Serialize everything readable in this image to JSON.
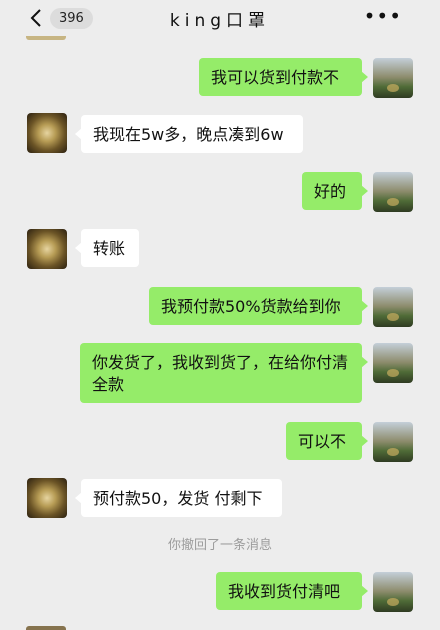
{
  "header": {
    "back_icon": "chevron-left-icon",
    "unread_count": "396",
    "title": "king口罩",
    "more_icon": "more-dots-icon"
  },
  "messages": [
    {
      "side": "right",
      "text": "我可以货到付款不"
    },
    {
      "side": "left",
      "text": "我现在5w多，晚点凑到6w"
    },
    {
      "side": "right",
      "text": "好的"
    },
    {
      "side": "left",
      "text": "转账"
    },
    {
      "side": "right",
      "text": "我预付款50%货款给到你"
    },
    {
      "side": "right",
      "text": "你发货了，我收到货了，在给你付清全款"
    },
    {
      "side": "right",
      "text": "可以不"
    },
    {
      "side": "left",
      "text": "预付款50，发货 付剩下"
    },
    {
      "side": "system",
      "text": "你撤回了一条消息"
    },
    {
      "side": "right",
      "text": "我收到货付清吧"
    }
  ],
  "colors": {
    "background": "#ededed",
    "my_bubble": "#95ec69",
    "their_bubble": "#ffffff"
  }
}
